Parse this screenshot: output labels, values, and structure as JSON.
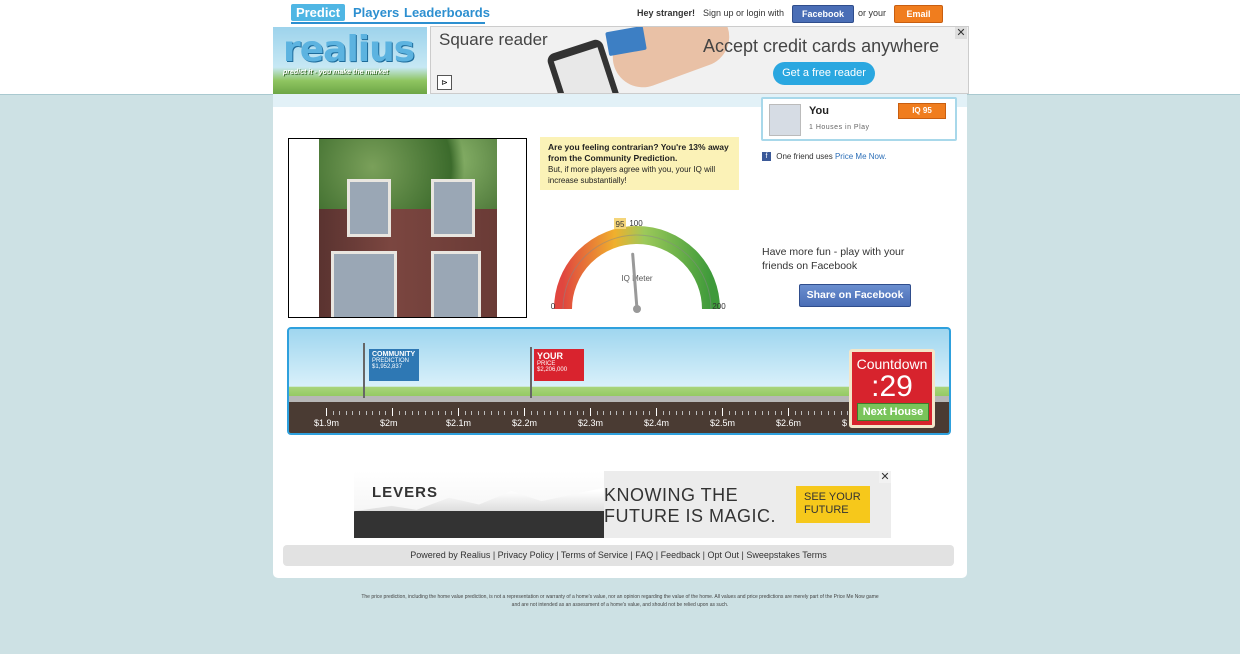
{
  "nav": {
    "predict": "Predict",
    "players": "Players",
    "leaderboards": "Leaderboards"
  },
  "auth": {
    "greeting": "Hey stranger!",
    "signup_text": "Sign up or login with",
    "facebook_label": "Facebook",
    "or_your": "or your",
    "email_label": "Email"
  },
  "logo": {
    "name": "realius",
    "tagline": "predict it - you make the market"
  },
  "ad_top": {
    "brand": "Square reader",
    "headline": "Accept credit cards anywhere",
    "cta": "Get a free reader"
  },
  "speech": {
    "bold": "Are you feeling contrarian? You're 13% away from the Community Prediction.",
    "text": "But, if more players agree with you, your IQ will increase substantially!"
  },
  "gauge": {
    "label": "IQ Meter",
    "min": "0",
    "max": "200",
    "mark100": "100",
    "value_label": "95",
    "value": 95
  },
  "profile": {
    "name": "You",
    "houses": "1 Houses in Play",
    "iq": "IQ 95"
  },
  "friend": {
    "text": "One friend uses",
    "link": "Price Me Now."
  },
  "share": {
    "text": "Have more fun - play with your friends on Facebook",
    "button": "Share on Facebook"
  },
  "game": {
    "community_title": "COMMUNITY",
    "community_sub": "PREDICTION",
    "community_value": "$1,952,837",
    "your_title": "YOUR",
    "your_sub": "PRICE",
    "your_value": "$2,206,000",
    "scale_labels": [
      "$1.9m",
      "$2m",
      "$2.1m",
      "$2.2m",
      "$2.3m",
      "$2.4m",
      "$2.5m",
      "$2.6m",
      "$"
    ]
  },
  "countdown": {
    "label": "Countdown",
    "value": ":29",
    "next": "Next House"
  },
  "ad_bottom": {
    "brand": "LEVERS",
    "headline1": "KNOWING THE",
    "headline2": "FUTURE IS MAGIC.",
    "cta1": "SEE YOUR",
    "cta2": "FUTURE"
  },
  "footer": {
    "powered": "Powered by Realius",
    "privacy": "Privacy Policy",
    "terms": "Terms of Service",
    "faq": "FAQ",
    "feedback": "Feedback",
    "optout": "Opt Out",
    "sweepstakes": "Sweepstakes Terms"
  },
  "disclaimer": "The price prediction, including the home value prediction, is not a representation or warranty of a home's value, nor an opinion regarding the value of the home. All values and price predictions are merely part of the Price Me Now game and are not intended as an assessment of a home's value, and should not be relied upon as such."
}
